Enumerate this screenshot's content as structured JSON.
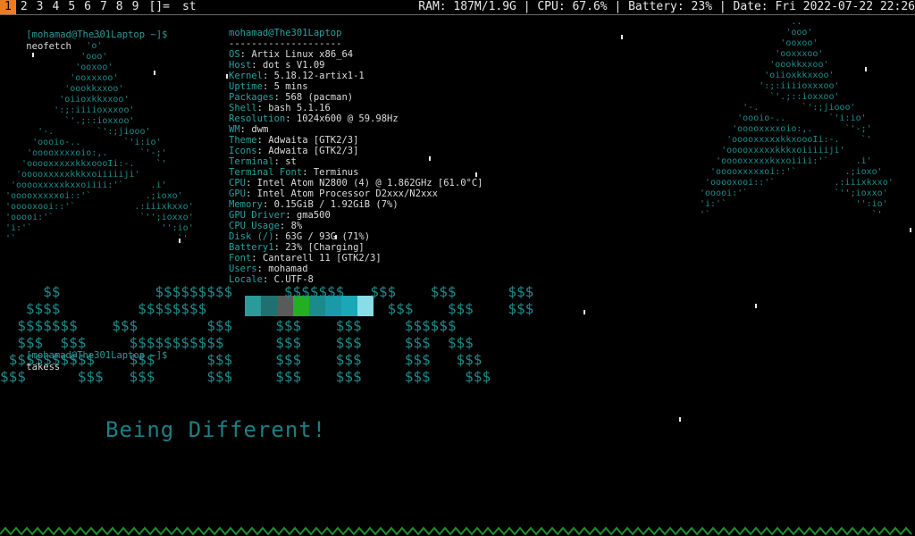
{
  "bar": {
    "tags": [
      "1",
      "2",
      "3",
      "4",
      "5",
      "6",
      "7",
      "8",
      "9"
    ],
    "active_tag": "1",
    "layout": "[]=",
    "window_title": "st",
    "status": "RAM: 187M/1.9G | CPU: 67.6% | Battery: 23% | Date: Fri 2022-07-22 22:26"
  },
  "terminal": {
    "prompt1": "[mohamad@The301Laptop ~]$",
    "cmd1": "neofetch",
    "prompt2": "[mohamad@The301Laptop ~]$",
    "cmd2": "takess"
  },
  "neofetch": {
    "logo_left": "                ..\n               'o'\n              'ooo'\n             'ooxoo'\n            'ooxxxoo'\n           'oookkxxoo'\n          'oiioxkkxxoo'\n         ':;:iiiioxxxoo'\n           `'.;::ioxxoo'\n      '-.        `':;jiooo'\n     'oooio-..        `'i:io'\n    'ooooxxxxoio:,.      `'-;'\n   'ooooxxxxxkkxoooIi:-.    `'\n  'ooooxxxxxkkkxoiiiiiji'\n 'ooooxxxxxkxxoiiii:'`     .i'\n'ooooxxxxxoi::'`          .;ioxo'\n'ooooxooi::'`           .:iiixkxxo'\n'ooooi:'`                `'';ioxxo'\n'i:'`                        '':io'\n'`                              `'",
    "logo_right": "                 ..\n                'ooo'\n               'ooxoo'\n              'ooxxxoo'\n             'oookkxxoo'\n            'oiioxkkxxoo'\n           ':;:iiiioxxxoo'\n             `'.;::ioxxoo'\n        '-.        `':;jiooo'\n       'oooio-..        `'i:io'\n      'ooooxxxxoio:,.      `'-;'\n     'ooooxxxxxkkxoooIi:-.    `'\n    'ooooxxxxxkkkxoiiiiiji'\n   'ooooxxxxxkxxoiiii:'`     .i'\n  'ooooxxxxxoi::'`         .;ioxo'\n 'ooooxooi::'`           .:iiixkxxo'\n'ooooi:'`                `'';ioxxo'\n'i:'`                        '':io'\n'`                              `'",
    "user": "mohamad@The301Laptop",
    "separator": "--------------------",
    "fields": [
      {
        "key": "OS",
        "value": "Artix Linux x86_64"
      },
      {
        "key": "Host",
        "value": "dot s V1.09"
      },
      {
        "key": "Kernel",
        "value": "5.18.12-artix1-1"
      },
      {
        "key": "Uptime",
        "value": "5 mins"
      },
      {
        "key": "Packages",
        "value": "568 (pacman)"
      },
      {
        "key": "Shell",
        "value": "bash 5.1.16"
      },
      {
        "key": "Resolution",
        "value": "1024x600 @ 59.98Hz"
      },
      {
        "key": "WM",
        "value": "dwm"
      },
      {
        "key": "Theme",
        "value": "Adwaita [GTK2/3]"
      },
      {
        "key": "Icons",
        "value": "Adwaita [GTK2/3]"
      },
      {
        "key": "Terminal",
        "value": "st"
      },
      {
        "key": "Terminal Font",
        "value": "Terminus"
      },
      {
        "key": "CPU",
        "value": "Intel Atom N2800 (4) @ 1.862GHz [61.0°C]"
      },
      {
        "key": "GPU",
        "value": "Intel Atom Processor D2xxx/N2xxx"
      },
      {
        "key": "Memory",
        "value": "0.15GiB / 1.92GiB (7%)"
      },
      {
        "key": "GPU Driver",
        "value": "gma500"
      },
      {
        "key": "CPU Usage",
        "value": "8%"
      },
      {
        "key": "Disk (/)",
        "value": "63G / 93G (71%)"
      },
      {
        "key": "Battery1",
        "value": "23% [Charging]"
      },
      {
        "key": "Font",
        "value": "Cantarell 11 [GTK2/3]"
      },
      {
        "key": "Users",
        "value": "mohamad"
      },
      {
        "key": "Locale",
        "value": "C.UTF-8"
      }
    ],
    "color_swatches": [
      "#000000",
      "#2a9a9a",
      "#1f7070",
      "#5a5a5a",
      "#22b022",
      "#1a8a8a",
      "#1a9aa8",
      "#1aa8b8",
      "#88dde6"
    ]
  },
  "takess": {
    "dollar_art": "     $$           $$$$$$$$$      $$$$$$$   $$$    $$$      $$$\n   $$$$         $$$$$$$$                     $$$    $$$    $$$\n  $$$$$$$    $$$        $$$     $$$    $$$     $$$$$$\n  $$$  $$$     $$$$$$$$$$$      $$$    $$$     $$$  $$$\n $$$$$$$$$$    $$$      $$$     $$$    $$$     $$$   $$$\n$$$      $$$   $$$      $$$     $$$    $$$     $$$    $$$",
    "tagline": "Being Different!"
  },
  "colors": {
    "accent": "#ef7b21",
    "teal": "#1d8c8c",
    "background": "#000000"
  }
}
